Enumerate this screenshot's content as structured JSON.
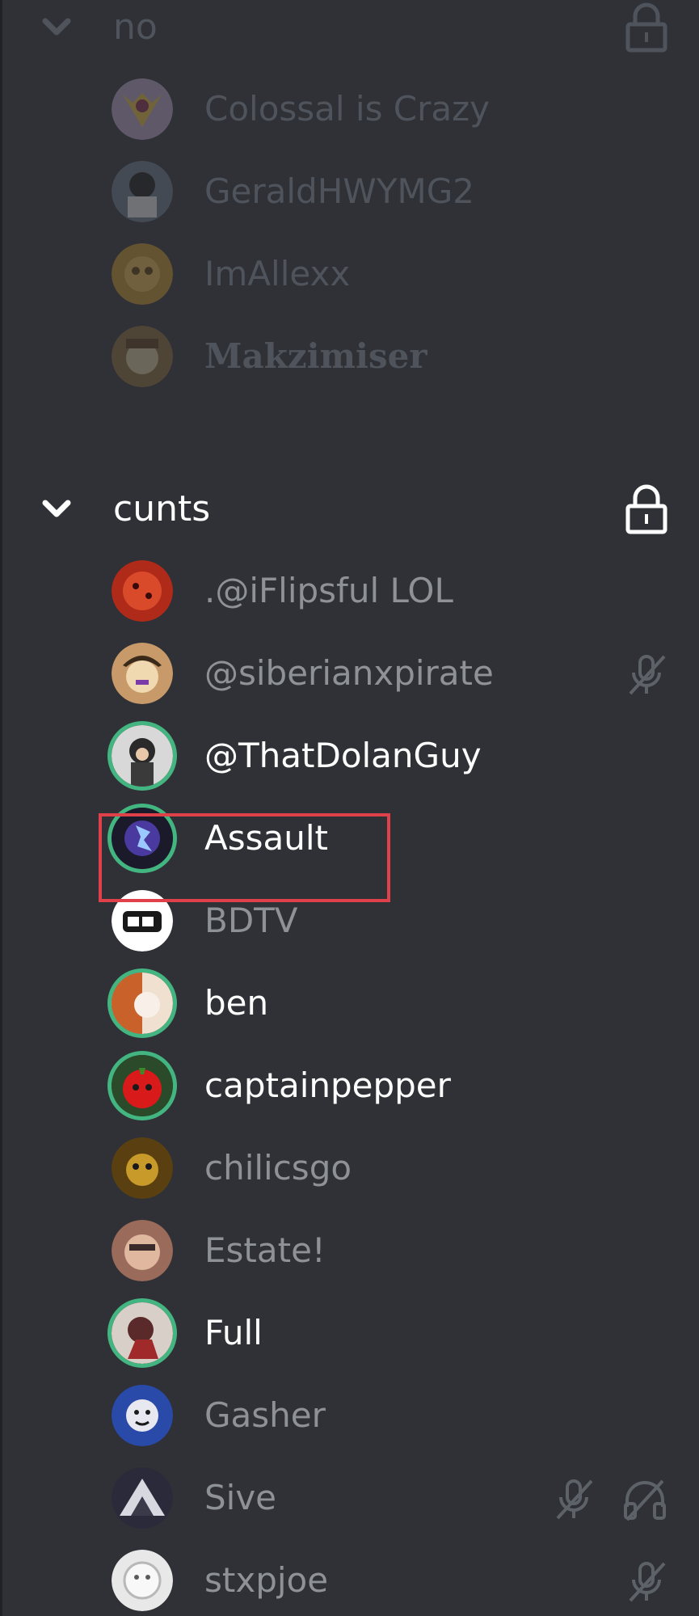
{
  "channels": [
    {
      "name": "no",
      "locked": true,
      "faded": true,
      "users": [
        {
          "name": "Colossal is Crazy",
          "speaking": false,
          "active": false,
          "avatar_color": "#b8a0c8",
          "status_icons": []
        },
        {
          "name": "GeraldHWYMG2",
          "speaking": false,
          "active": false,
          "avatar_color": "#4a5a6a",
          "status_icons": []
        },
        {
          "name": "ImAllexx",
          "speaking": false,
          "active": false,
          "avatar_color": "#c8922a",
          "status_icons": []
        },
        {
          "name": "Makzimiser",
          "speaking": false,
          "active": false,
          "avatar_color": "#8a6a3a",
          "status_icons": []
        }
      ]
    },
    {
      "name": "cunts",
      "locked": true,
      "faded": false,
      "users": [
        {
          "name": ".@iFlipsful LOL",
          "speaking": false,
          "active": false,
          "avatar_color": "#b02a1a",
          "status_icons": []
        },
        {
          "name": "@siberianxpirate",
          "speaking": false,
          "active": false,
          "avatar_color": "#c89a6a",
          "status_icons": [
            "muted-mic-icon"
          ]
        },
        {
          "name": "@ThatDolanGuy",
          "speaking": true,
          "active": true,
          "avatar_color": "#3a3a3a",
          "status_icons": []
        },
        {
          "name": "Assault",
          "speaking": true,
          "active": true,
          "avatar_color": "#3a2a6a",
          "status_icons": []
        },
        {
          "name": "BDTV",
          "speaking": false,
          "active": false,
          "avatar_color": "#ffffff",
          "status_icons": []
        },
        {
          "name": "ben",
          "speaking": true,
          "active": true,
          "avatar_color": "#e8c8a8",
          "status_icons": []
        },
        {
          "name": "captainpepper",
          "speaking": true,
          "active": true,
          "avatar_color": "#c81a1a",
          "status_icons": []
        },
        {
          "name": "chilicsgo",
          "speaking": false,
          "active": false,
          "avatar_color": "#7a5a1a",
          "status_icons": []
        },
        {
          "name": "Estate!",
          "speaking": false,
          "active": false,
          "avatar_color": "#9a6a5a",
          "status_icons": []
        },
        {
          "name": "Full",
          "speaking": true,
          "active": true,
          "avatar_color": "#5a2a2a",
          "status_icons": []
        },
        {
          "name": "Gasher",
          "speaking": false,
          "active": false,
          "avatar_color": "#3a6aca",
          "status_icons": []
        },
        {
          "name": "Sive",
          "speaking": false,
          "active": false,
          "avatar_color": "#3a3a4a",
          "status_icons": [
            "muted-mic-icon",
            "deafened-headphones-icon"
          ]
        },
        {
          "name": "stxpjoe",
          "speaking": false,
          "active": false,
          "avatar_color": "#e8e8e8",
          "status_icons": [
            "muted-mic-icon"
          ]
        }
      ]
    }
  ],
  "colors": {
    "background": "#2f3136",
    "speaking_ring": "#43b581",
    "highlight_box": "#e0404a",
    "text_active": "#ffffff",
    "text_idle": "#8e9297",
    "text_faded": "#4f545c"
  },
  "highlighted_user": "Assault"
}
